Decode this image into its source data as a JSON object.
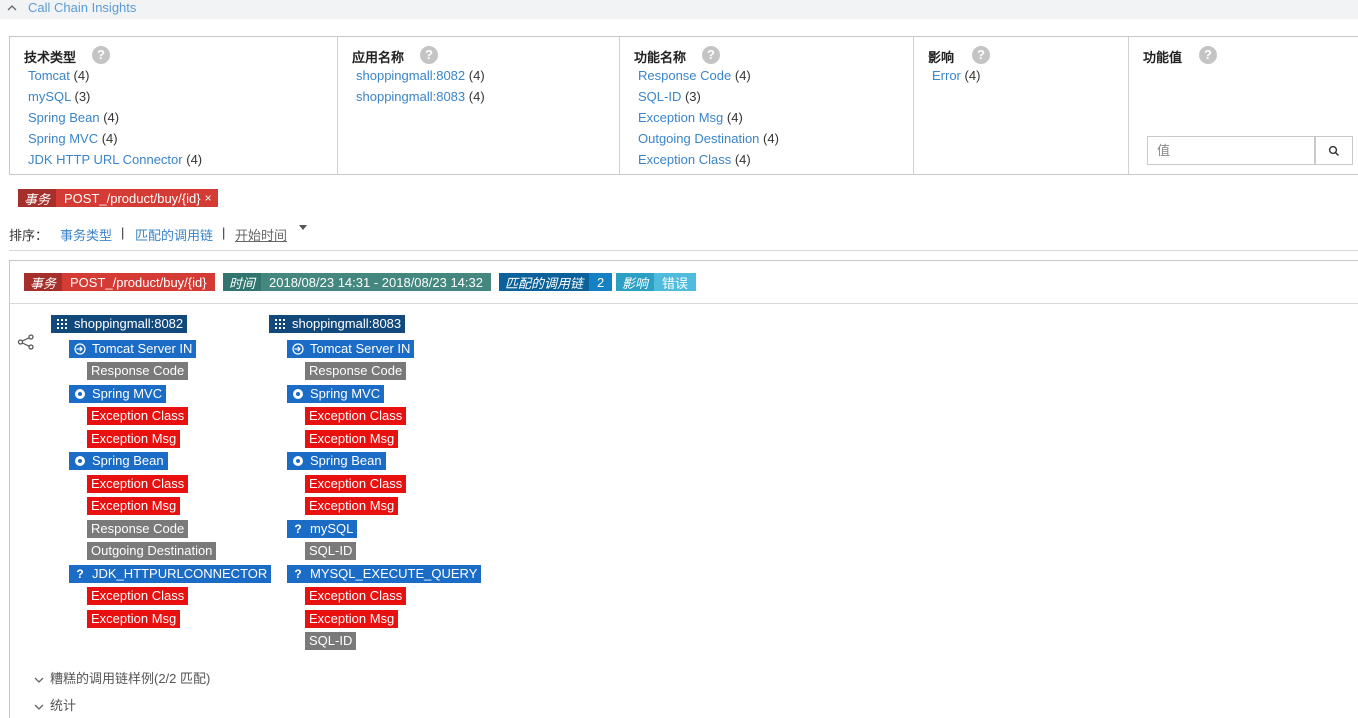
{
  "panel": {
    "title": "Call Chain Insights"
  },
  "filters": {
    "columns": [
      {
        "header": "技术类型",
        "items": [
          {
            "label": "Tomcat",
            "count": "(4)"
          },
          {
            "label": "mySQL",
            "count": "(3)"
          },
          {
            "label": "Spring Bean",
            "count": "(4)"
          },
          {
            "label": "Spring MVC",
            "count": "(4)"
          },
          {
            "label": "JDK HTTP URL Connector",
            "count": "(4)"
          }
        ]
      },
      {
        "header": "应用名称",
        "items": [
          {
            "label": "shoppingmall:8082",
            "count": "(4)"
          },
          {
            "label": "shoppingmall:8083",
            "count": "(4)"
          }
        ]
      },
      {
        "header": "功能名称",
        "items": [
          {
            "label": "Response Code",
            "count": "(4)"
          },
          {
            "label": "SQL-ID",
            "count": "(3)"
          },
          {
            "label": "Exception Msg",
            "count": "(4)"
          },
          {
            "label": "Outgoing Destination",
            "count": "(4)"
          },
          {
            "label": "Exception Class",
            "count": "(4)"
          }
        ]
      },
      {
        "header": "影响",
        "items": [
          {
            "label": "Error",
            "count": "(4)"
          }
        ]
      },
      {
        "header": "功能值",
        "items": []
      }
    ],
    "help_glyph": "?",
    "value_placeholder": "值"
  },
  "active_filter": {
    "key": "事务",
    "value": "POST_/product/buy/{id}",
    "remove": "×"
  },
  "sort": {
    "label": "排序：",
    "options": [
      "事务类型",
      "匹配的调用链",
      "开始时间"
    ],
    "separator": "|"
  },
  "result": {
    "chips": [
      {
        "key": "事务",
        "value": "POST_/product/buy/{id}",
        "style": "red"
      },
      {
        "key": "时间",
        "value": "2018/08/23 14:31 - 2018/08/23 14:32",
        "style": "teal"
      },
      {
        "key": "匹配的调用链",
        "value": "2",
        "style": "blue"
      },
      {
        "key": "影响",
        "value": "错误",
        "style": "cyan"
      }
    ],
    "apps": [
      {
        "name": "shoppingmall:8082",
        "nodes": [
          {
            "kind": "comp",
            "icon": "enter",
            "label": "Tomcat Server IN"
          },
          {
            "kind": "gray",
            "label": "Response Code"
          },
          {
            "kind": "comp",
            "icon": "gear",
            "label": "Spring MVC"
          },
          {
            "kind": "err",
            "label": "Exception Class"
          },
          {
            "kind": "err",
            "label": "Exception Msg"
          },
          {
            "kind": "comp",
            "icon": "gear",
            "label": "Spring Bean"
          },
          {
            "kind": "err",
            "label": "Exception Class"
          },
          {
            "kind": "err",
            "label": "Exception Msg"
          },
          {
            "kind": "gray",
            "label": "Response Code"
          },
          {
            "kind": "gray",
            "label": "Outgoing Destination"
          },
          {
            "kind": "comp",
            "icon": "question",
            "label": "JDK_HTTPURLCONNECTOR"
          },
          {
            "kind": "err",
            "label": "Exception Class"
          },
          {
            "kind": "err",
            "label": "Exception Msg"
          }
        ]
      },
      {
        "name": "shoppingmall:8083",
        "nodes": [
          {
            "kind": "comp",
            "icon": "enter",
            "label": "Tomcat Server IN"
          },
          {
            "kind": "gray",
            "label": "Response Code"
          },
          {
            "kind": "comp",
            "icon": "gear",
            "label": "Spring MVC"
          },
          {
            "kind": "err",
            "label": "Exception Class"
          },
          {
            "kind": "err",
            "label": "Exception Msg"
          },
          {
            "kind": "comp",
            "icon": "gear",
            "label": "Spring Bean"
          },
          {
            "kind": "err",
            "label": "Exception Class"
          },
          {
            "kind": "err",
            "label": "Exception Msg"
          },
          {
            "kind": "comp",
            "icon": "question",
            "label": "mySQL"
          },
          {
            "kind": "gray",
            "label": "SQL-ID"
          },
          {
            "kind": "comp",
            "icon": "question",
            "label": "MYSQL_EXECUTE_QUERY"
          },
          {
            "kind": "err",
            "label": "Exception Class"
          },
          {
            "kind": "err",
            "label": "Exception Msg"
          },
          {
            "kind": "gray",
            "label": "SQL-ID"
          }
        ]
      }
    ],
    "sections": [
      {
        "label": "糟糕的调用链样例(2/2 匹配)"
      },
      {
        "label": "统计"
      }
    ]
  },
  "colors": {
    "link": "#3a84c9",
    "app_node": "#11497c",
    "component_node": "#1a6cc6",
    "attribute_node": "#7a7a7a",
    "error_node": "#e91010",
    "chip_red": "#d33b34"
  }
}
